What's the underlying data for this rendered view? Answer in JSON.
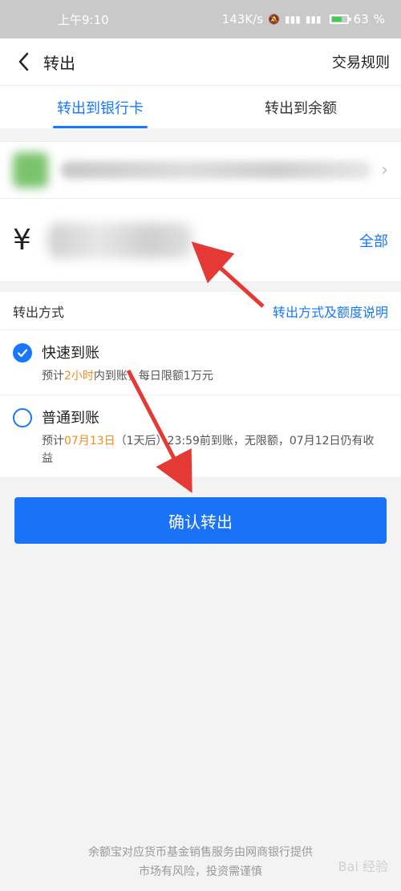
{
  "status_bar": {
    "time": "上午9:10",
    "net_speed": "143K/s",
    "battery": "63"
  },
  "nav": {
    "title": "转出",
    "right": "交易规则"
  },
  "tabs": [
    {
      "label": "转出到银行卡",
      "active": true
    },
    {
      "label": "转出到余额",
      "active": false
    }
  ],
  "amount": {
    "currency": "¥",
    "all_label": "全部"
  },
  "method": {
    "title": "转出方式",
    "link": "转出方式及额度说明"
  },
  "options": [
    {
      "title": "快速到账",
      "desc_prefix": "预计",
      "desc_highlight": "2小时",
      "desc_suffix": "内到账，每日限额1万元"
    },
    {
      "title": "普通到账",
      "desc_prefix": "预计",
      "desc_highlight": "07月13日",
      "desc_suffix": "（1天后）23:59前到账，无限额，07月12日仍有收益"
    }
  ],
  "confirm": "确认转出",
  "footer": {
    "line1": "余额宝对应货币基金销售服务由网商银行提供",
    "line2": "市场有风险，投资需谨慎"
  },
  "watermark": "Bai 经验",
  "colors": {
    "accent": "#1677ff",
    "highlight": "#f08b21",
    "arrow": "#e53935"
  }
}
